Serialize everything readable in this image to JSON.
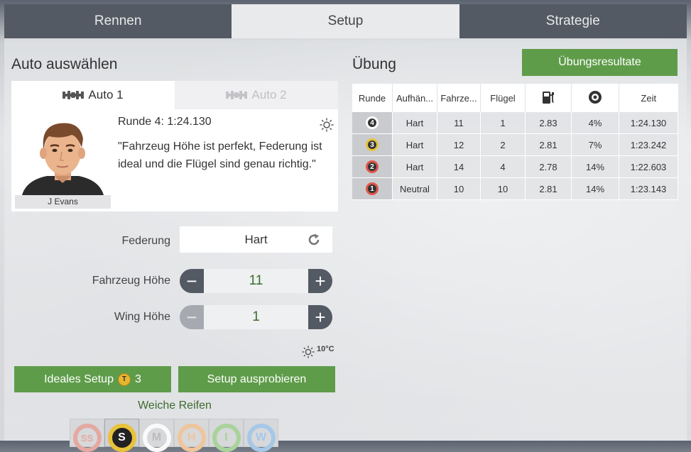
{
  "tabs": [
    {
      "label": "Rennen",
      "active": false
    },
    {
      "label": "Setup",
      "active": true
    },
    {
      "label": "Strategie",
      "active": false
    }
  ],
  "left": {
    "heading": "Auto auswählen",
    "car_tabs": [
      {
        "label": "Auto 1",
        "active": true
      },
      {
        "label": "Auto 2",
        "active": false
      }
    ],
    "driver": {
      "name": "J Evans",
      "lap_info": "Runde 4: 1:24.130",
      "quote": "\"Fahrzeug Höhe ist perfekt, Federung ist ideal und die Flügel sind genau richtig.\"",
      "weather_icon": "sun-icon"
    },
    "federung": {
      "label": "Federung",
      "value": "Hart"
    },
    "fahrzeug_hoehe": {
      "label": "Fahrzeug Höhe",
      "value": "11",
      "minus": "−",
      "plus": "+"
    },
    "wing_hoehe": {
      "label": "Wing Höhe",
      "value": "1",
      "minus": "−",
      "plus": "+"
    },
    "weather": {
      "temp": "10°C"
    },
    "ideal_button": {
      "label": "Ideales Setup",
      "coin": "T",
      "count": "3"
    },
    "try_button": {
      "label": "Setup ausprobieren"
    },
    "tyre_label": "Weiche Reifen",
    "tyres": [
      {
        "code": "SS",
        "color": "#e07a6e",
        "selected": false
      },
      {
        "code": "S",
        "color": "#e8c23a",
        "selected": true
      },
      {
        "code": "M",
        "color": "#ffffff",
        "selected": false
      },
      {
        "code": "H",
        "color": "#f0a35a",
        "selected": false
      },
      {
        "code": "I",
        "color": "#7fbf6a",
        "selected": false
      },
      {
        "code": "W",
        "color": "#6fa8dc",
        "selected": false
      }
    ]
  },
  "right": {
    "heading": "Übung",
    "results_button": "Übungsresultate",
    "columns": [
      "Runde",
      "Aufhän...",
      "Fahrze...",
      "Flügel",
      "fuel-icon",
      "tyre-wear-icon",
      "Zeit"
    ],
    "rows": [
      {
        "lap": "4",
        "tyre": "M",
        "badge": "#ffffff",
        "susp": "Hart",
        "height": "11",
        "wing": "1",
        "fuel": "2.83",
        "wear": "4%",
        "time": "1:24.130"
      },
      {
        "lap": "3",
        "tyre": "S",
        "badge": "#e8c23a",
        "susp": "Hart",
        "height": "12",
        "wing": "2",
        "fuel": "2.81",
        "wear": "7%",
        "time": "1:23.242"
      },
      {
        "lap": "2",
        "tyre": "SS",
        "badge": "#e0564a",
        "susp": "Hart",
        "height": "14",
        "wing": "4",
        "fuel": "2.78",
        "wear": "14%",
        "time": "1:22.603"
      },
      {
        "lap": "1",
        "tyre": "SS",
        "badge": "#e0564a",
        "susp": "Neutral",
        "height": "10",
        "wing": "10",
        "fuel": "2.81",
        "wear": "14%",
        "time": "1:23.143"
      }
    ]
  }
}
